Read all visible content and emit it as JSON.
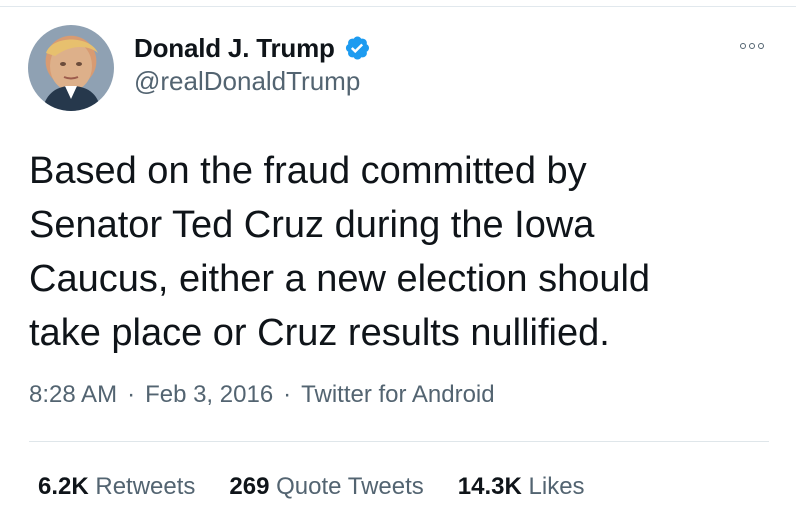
{
  "user": {
    "display_name": "Donald J. Trump",
    "handle": "@realDonaldTrump",
    "verified_icon": "verified-badge-icon",
    "verified_color": "#1d9bf0"
  },
  "tweet": {
    "text": "Based on the fraud committed by\nSenator Ted Cruz during the Iowa\nCaucus, either a new election should\ntake place or Cruz results nullified.",
    "time": "8:28 AM",
    "separator_1": "·",
    "date": "Feb 3, 2016",
    "separator_2": "·",
    "source": "Twitter for Android"
  },
  "stats": {
    "retweets_count": "6.2K",
    "retweets_label": "Retweets",
    "quotes_count": "269",
    "quotes_label": "Quote Tweets",
    "likes_count": "14.3K",
    "likes_label": "Likes"
  },
  "colors": {
    "text": "#0f1419",
    "secondary": "#536471",
    "divider": "#dfe6ea"
  },
  "icons": {
    "more": "more-options-icon",
    "avatar": "profile-photo"
  }
}
